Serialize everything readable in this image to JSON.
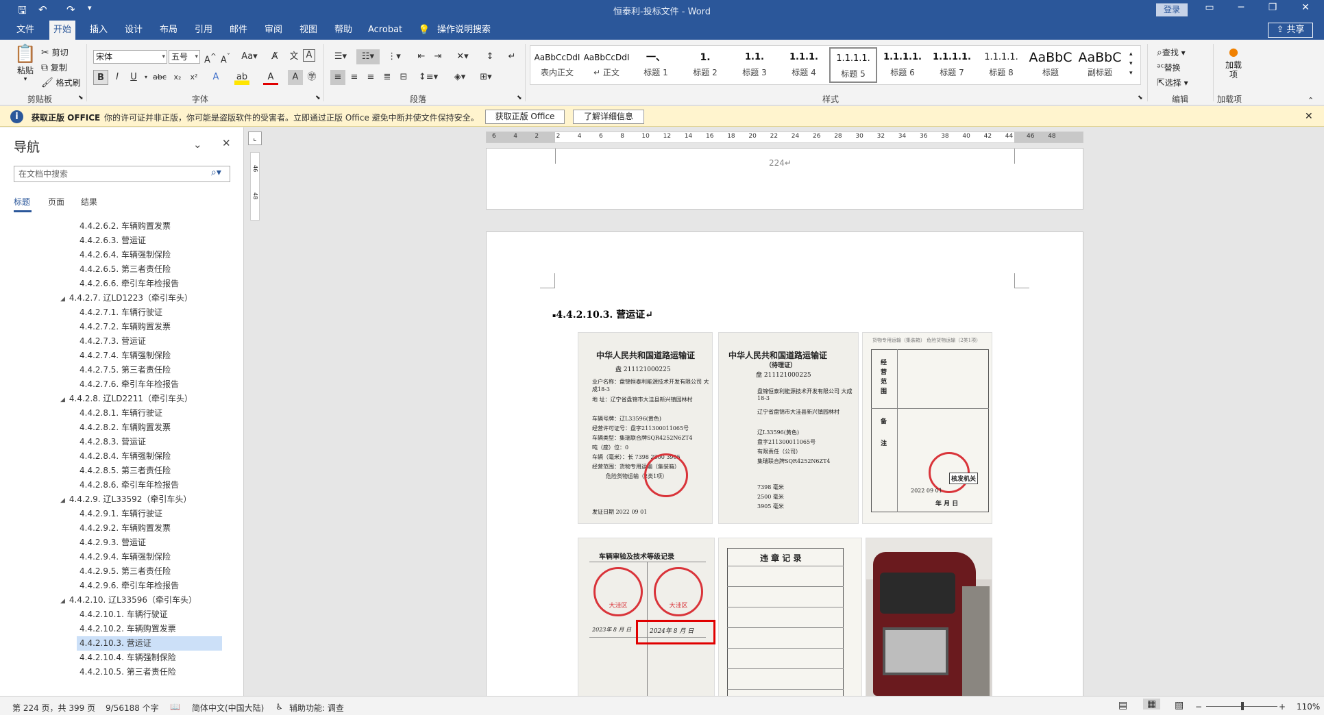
{
  "window": {
    "title": "恒泰利-投标文件  -  Word",
    "login": "登录"
  },
  "tabs": [
    {
      "label": "文件"
    },
    {
      "label": "开始"
    },
    {
      "label": "插入"
    },
    {
      "label": "设计"
    },
    {
      "label": "布局"
    },
    {
      "label": "引用"
    },
    {
      "label": "邮件"
    },
    {
      "label": "审阅"
    },
    {
      "label": "视图"
    },
    {
      "label": "帮助"
    },
    {
      "label": "Acrobat"
    },
    {
      "label": "操作说明搜索"
    }
  ],
  "share": "共享",
  "clipboard": {
    "paste": "粘贴",
    "cut": "剪切",
    "copy": "复制",
    "format_painter": "格式刷",
    "group": "剪贴板"
  },
  "font": {
    "name": "宋体",
    "size": "五号",
    "group": "字体"
  },
  "paragraph": {
    "group": "段落"
  },
  "styles": {
    "group": "样式",
    "items": [
      {
        "preview": "AaBbCcDdI",
        "name": "表内正文"
      },
      {
        "preview": "AaBbCcDdI",
        "name": "正文"
      },
      {
        "preview": "一、",
        "name": "标题 1"
      },
      {
        "preview": "1.",
        "name": "标题 2"
      },
      {
        "preview": "1.1.",
        "name": "标题 3"
      },
      {
        "preview": "1.1.1.",
        "name": "标题 4"
      },
      {
        "preview": "1.1.1.1.",
        "name": "标题 5"
      },
      {
        "preview": "1.1.1.1.",
        "name": "标题 6"
      },
      {
        "preview": "1.1.1.1.",
        "name": "标题 7"
      },
      {
        "preview": "1.1.1.1.",
        "name": "标题 8"
      },
      {
        "preview": "AaBbC",
        "name": "标题"
      },
      {
        "preview": "AaBbC",
        "name": "副标题"
      }
    ]
  },
  "editing": {
    "find": "查找",
    "replace": "替换",
    "select": "选择",
    "group": "编辑"
  },
  "addins": {
    "label": "加载项",
    "group": "加载项"
  },
  "message_bar": {
    "title": "获取正版 OFFICE",
    "text": "你的许可证并非正版，你可能是盗版软件的受害者。立即通过正版 Office 避免中断并使文件保持安全。",
    "btn_get": "获取正版 Office",
    "btn_more": "了解详细信息"
  },
  "nav": {
    "title": "导航",
    "search_placeholder": "在文档中搜索",
    "tabs": [
      {
        "label": "标题"
      },
      {
        "label": "页面"
      },
      {
        "label": "结果"
      }
    ],
    "items": [
      {
        "label": "4.4.2.6.2. 车辆购置发票",
        "level": 2
      },
      {
        "label": "4.4.2.6.3. 营运证",
        "level": 2
      },
      {
        "label": "4.4.2.6.4. 车辆强制保险",
        "level": 2
      },
      {
        "label": "4.4.2.6.5. 第三者责任险",
        "level": 2
      },
      {
        "label": "4.4.2.6.6. 牵引车年检报告",
        "level": 2
      },
      {
        "label": "4.4.2.7. 辽LD1223（牵引车头）",
        "level": 1
      },
      {
        "label": "4.4.2.7.1. 车辆行驶证",
        "level": 2
      },
      {
        "label": "4.4.2.7.2. 车辆购置发票",
        "level": 2
      },
      {
        "label": "4.4.2.7.3. 营运证",
        "level": 2
      },
      {
        "label": "4.4.2.7.4. 车辆强制保险",
        "level": 2
      },
      {
        "label": "4.4.2.7.5. 第三者责任险",
        "level": 2
      },
      {
        "label": "4.4.2.7.6. 牵引车年检报告",
        "level": 2
      },
      {
        "label": "4.4.2.8. 辽LD2211（牵引车头）",
        "level": 1
      },
      {
        "label": "4.4.2.8.1. 车辆行驶证",
        "level": 2
      },
      {
        "label": "4.4.2.8.2. 车辆购置发票",
        "level": 2
      },
      {
        "label": "4.4.2.8.3. 营运证",
        "level": 2
      },
      {
        "label": "4.4.2.8.4. 车辆强制保险",
        "level": 2
      },
      {
        "label": "4.4.2.8.5. 第三者责任险",
        "level": 2
      },
      {
        "label": "4.4.2.8.6. 牵引车年检报告",
        "level": 2
      },
      {
        "label": "4.4.2.9. 辽L33592（牵引车头）",
        "level": 1
      },
      {
        "label": "4.4.2.9.1. 车辆行驶证",
        "level": 2
      },
      {
        "label": "4.4.2.9.2. 车辆购置发票",
        "level": 2
      },
      {
        "label": "4.4.2.9.3. 营运证",
        "level": 2
      },
      {
        "label": "4.4.2.9.4. 车辆强制保险",
        "level": 2
      },
      {
        "label": "4.4.2.9.5. 第三者责任险",
        "level": 2
      },
      {
        "label": "4.4.2.9.6. 牵引车年检报告",
        "level": 2
      },
      {
        "label": "4.4.2.10. 辽L33596（牵引车头）",
        "level": 1
      },
      {
        "label": "4.4.2.10.1. 车辆行驶证",
        "level": 2
      },
      {
        "label": "4.4.2.10.2. 车辆购置发票",
        "level": 2
      },
      {
        "label": "4.4.2.10.3. 营运证",
        "level": 2,
        "selected": true
      },
      {
        "label": "4.4.2.10.4. 车辆强制保险",
        "level": 2
      },
      {
        "label": "4.4.2.10.5. 第三者责任险",
        "level": 2
      }
    ]
  },
  "ruler_ticks": [
    "6",
    "4",
    "2",
    "2",
    "4",
    "6",
    "8",
    "10",
    "12",
    "14",
    "16",
    "18",
    "20",
    "22",
    "24",
    "26",
    "28",
    "30",
    "32",
    "34",
    "36",
    "38",
    "40",
    "42",
    "44",
    "46",
    "48"
  ],
  "vruler_ticks": [
    "46",
    "48"
  ],
  "document": {
    "page_number": "224↵",
    "heading": "4.4.2.10.3. 营运证↵"
  },
  "scans": {
    "card1_title": "中华人民共和国道路运输证",
    "card1_no": "盘    211121000225",
    "card1_rows": [
      "业户名称：盘锦恒泰利能源技术开发有限公司 大成18-3",
      "地    址：辽宁省盘锦市大洼县新兴镇园林村",
      "车辆号牌：辽L33596(黄色)",
      "经营许可证号：盘字211300011065号",
      "车辆类型：集瑞联合牌SQR4252N6ZT4",
      "吨（座）位：0",
      "车辆（毫米）：长 7398  2500  3905",
      "经营范围：货物专用运输（集装箱）",
      "危险货物运输（2类1项）",
      "发证日期  2022  09  01"
    ],
    "card2_title": "中华人民共和国道路运输证",
    "card2_sub": "（待理证）",
    "card2_no": "盘    211121000225",
    "card2_rows": [
      "盘锦恒泰利能源技术开发有限公司 大成18-3",
      "辽宁省盘锦市大洼县新兴镇园林村",
      "辽L33596(黄色)",
      "盘字211300011065号",
      "有限责任（公司）",
      "集瑞联合牌SQR4252N6ZT4",
      "7398  毫米",
      "2500  毫米",
      "3905  毫米"
    ],
    "card3_header": "货物专用运输（集装箱） 危险货物运输（2类1项）",
    "card3_labels": [
      "经",
      "营",
      "范",
      "围",
      "备",
      "注"
    ],
    "card3_stamp": "核发机关",
    "card3_date": "2022    09    01",
    "card3_ymd": "年    月    日",
    "card4_title": "车辆审验及技术等级记录",
    "card4_stamp": "大洼区",
    "card4_date1": "2023年 8 月   日",
    "card4_date2": "2024年 8 月   日",
    "card5_title": "违 章 记 录"
  },
  "status": {
    "page": "第 224 页，共 399 页",
    "words": "9/56188 个字",
    "language": "简体中文(中国大陆)",
    "accessibility": "辅助功能: 调查",
    "zoom": "110%"
  }
}
